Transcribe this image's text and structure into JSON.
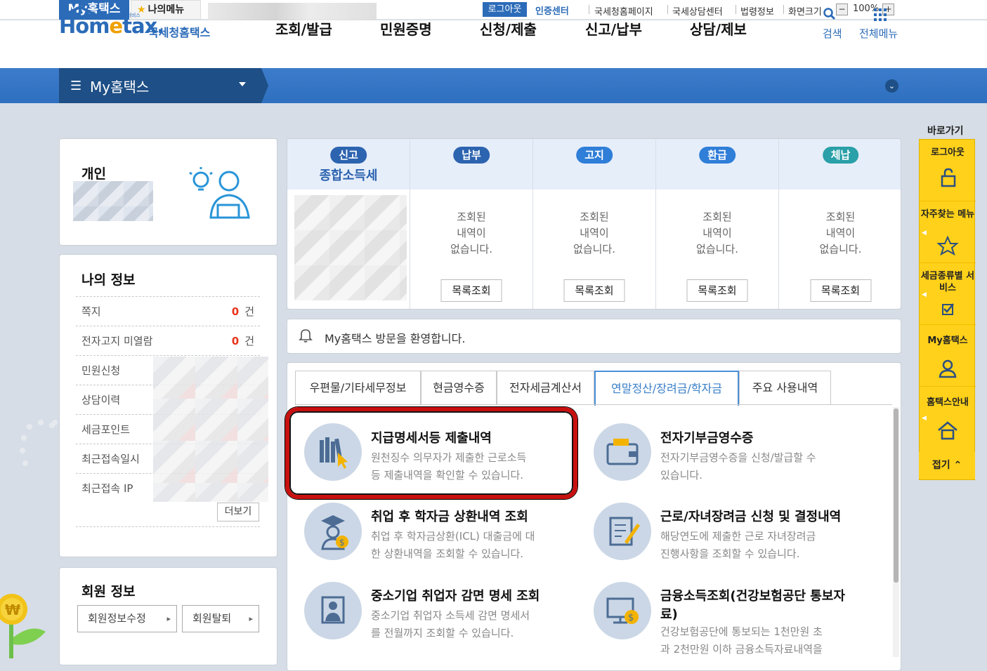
{
  "topbar": {
    "tabs": {
      "myhometax": "My홈택스",
      "mymenu": "나의메뉴"
    },
    "logout": "로그아웃",
    "cert": "인증센터",
    "links": [
      "국세청홈페이지",
      "국세상담센터",
      "법령정보",
      "화면크기"
    ],
    "zoom": "100%"
  },
  "header": {
    "logo_small": "편리한 납세서비스",
    "logo_en_pre": "Hom",
    "logo_en_e": "e",
    "logo_en_post": "tax.",
    "logo_ko": "국세청홈택스",
    "nav": [
      "조회/발급",
      "민원증명",
      "신청/제출",
      "신고/납부",
      "상담/제보"
    ],
    "search": "검색",
    "allmenu": "전체메뉴"
  },
  "mybar": {
    "label": "My홈택스"
  },
  "personal": {
    "title": "개인"
  },
  "myinfo": {
    "title": "나의 정보",
    "rows": [
      {
        "label": "쪽지",
        "count": "0",
        "unit": "건"
      },
      {
        "label": "전자고지 미열람",
        "count": "0",
        "unit": "건"
      },
      {
        "label": "민원신청"
      },
      {
        "label": "상담이력"
      },
      {
        "label": "세금포인트"
      },
      {
        "label": "최근접속일시"
      },
      {
        "label": "최근접속 IP"
      }
    ],
    "more": "더보기"
  },
  "member": {
    "title": "회원 정보",
    "edit": "회원정보수정",
    "withdraw": "회원탈퇴"
  },
  "status": {
    "columns": [
      {
        "pill": "신고",
        "color": "#2d64b0",
        "sub": "종합소득세"
      },
      {
        "pill": "납부",
        "color": "#2d64b0",
        "msg": [
          "조회된",
          "내역이",
          "없습니다."
        ],
        "btn": "목록조회"
      },
      {
        "pill": "고지",
        "color": "#2f7ed8",
        "msg": [
          "조회된",
          "내역이",
          "없습니다."
        ],
        "btn": "목록조회"
      },
      {
        "pill": "환급",
        "color": "#2f7ed8",
        "msg": [
          "조회된",
          "내역이",
          "없습니다."
        ],
        "btn": "목록조회"
      },
      {
        "pill": "체납",
        "color": "#2aa0a8",
        "msg": [
          "조회된",
          "내역이",
          "없습니다."
        ],
        "btn": "목록조회"
      }
    ]
  },
  "notice": {
    "text": "My홈택스 방문을 환영합니다."
  },
  "tabs": [
    "우편물/기타세무정보",
    "현금영수증",
    "전자세금계산서",
    "연말정산/장려금/학자금",
    "주요 사용내역"
  ],
  "services": [
    {
      "title": "지급명세서등 제출내역",
      "desc": [
        "원천징수 의무자가 제출한 근로소득",
        "등 제출내역을 확인할 수 있습니다."
      ]
    },
    {
      "title": "전자기부금영수증",
      "desc": [
        "전자기부금영수증을 신청/발급할 수",
        "있습니다."
      ]
    },
    {
      "title": "취업 후 학자금 상환내역 조회",
      "desc": [
        "취업 후 학자금상환(ICL) 대출금에 대",
        "한 상환내역을 조회할 수 있습니다."
      ]
    },
    {
      "title": "근로/자녀장려금 신청 및 결정내역",
      "desc": [
        "해당연도에 제출한 근로 자녀장려금",
        "진행사항을 조회할 수 있습니다."
      ]
    },
    {
      "title": "중소기업 취업자 감면 명세 조회",
      "desc": [
        "중소기업 취업자 소득세 감면 명세서",
        "를 전월까지 조회할 수 있습니다."
      ]
    },
    {
      "title": "금융소득조회(건강보험공단 통보자",
      "title2": "료)",
      "desc": [
        "건강보험공단에 통보되는 1천만원 초",
        "과 2천만원 이하 금융소득자료내역을"
      ]
    }
  ],
  "quick": {
    "title": "바로가기",
    "items": [
      "로그아웃",
      "자주찾는 메뉴",
      "세금종류별 서비스",
      "My홈택스",
      "홈택스안내"
    ],
    "fold": "접기"
  },
  "colors": {
    "brand": "#2b6bb8",
    "accent": "#ffd11a",
    "highlight": "#c81010"
  }
}
